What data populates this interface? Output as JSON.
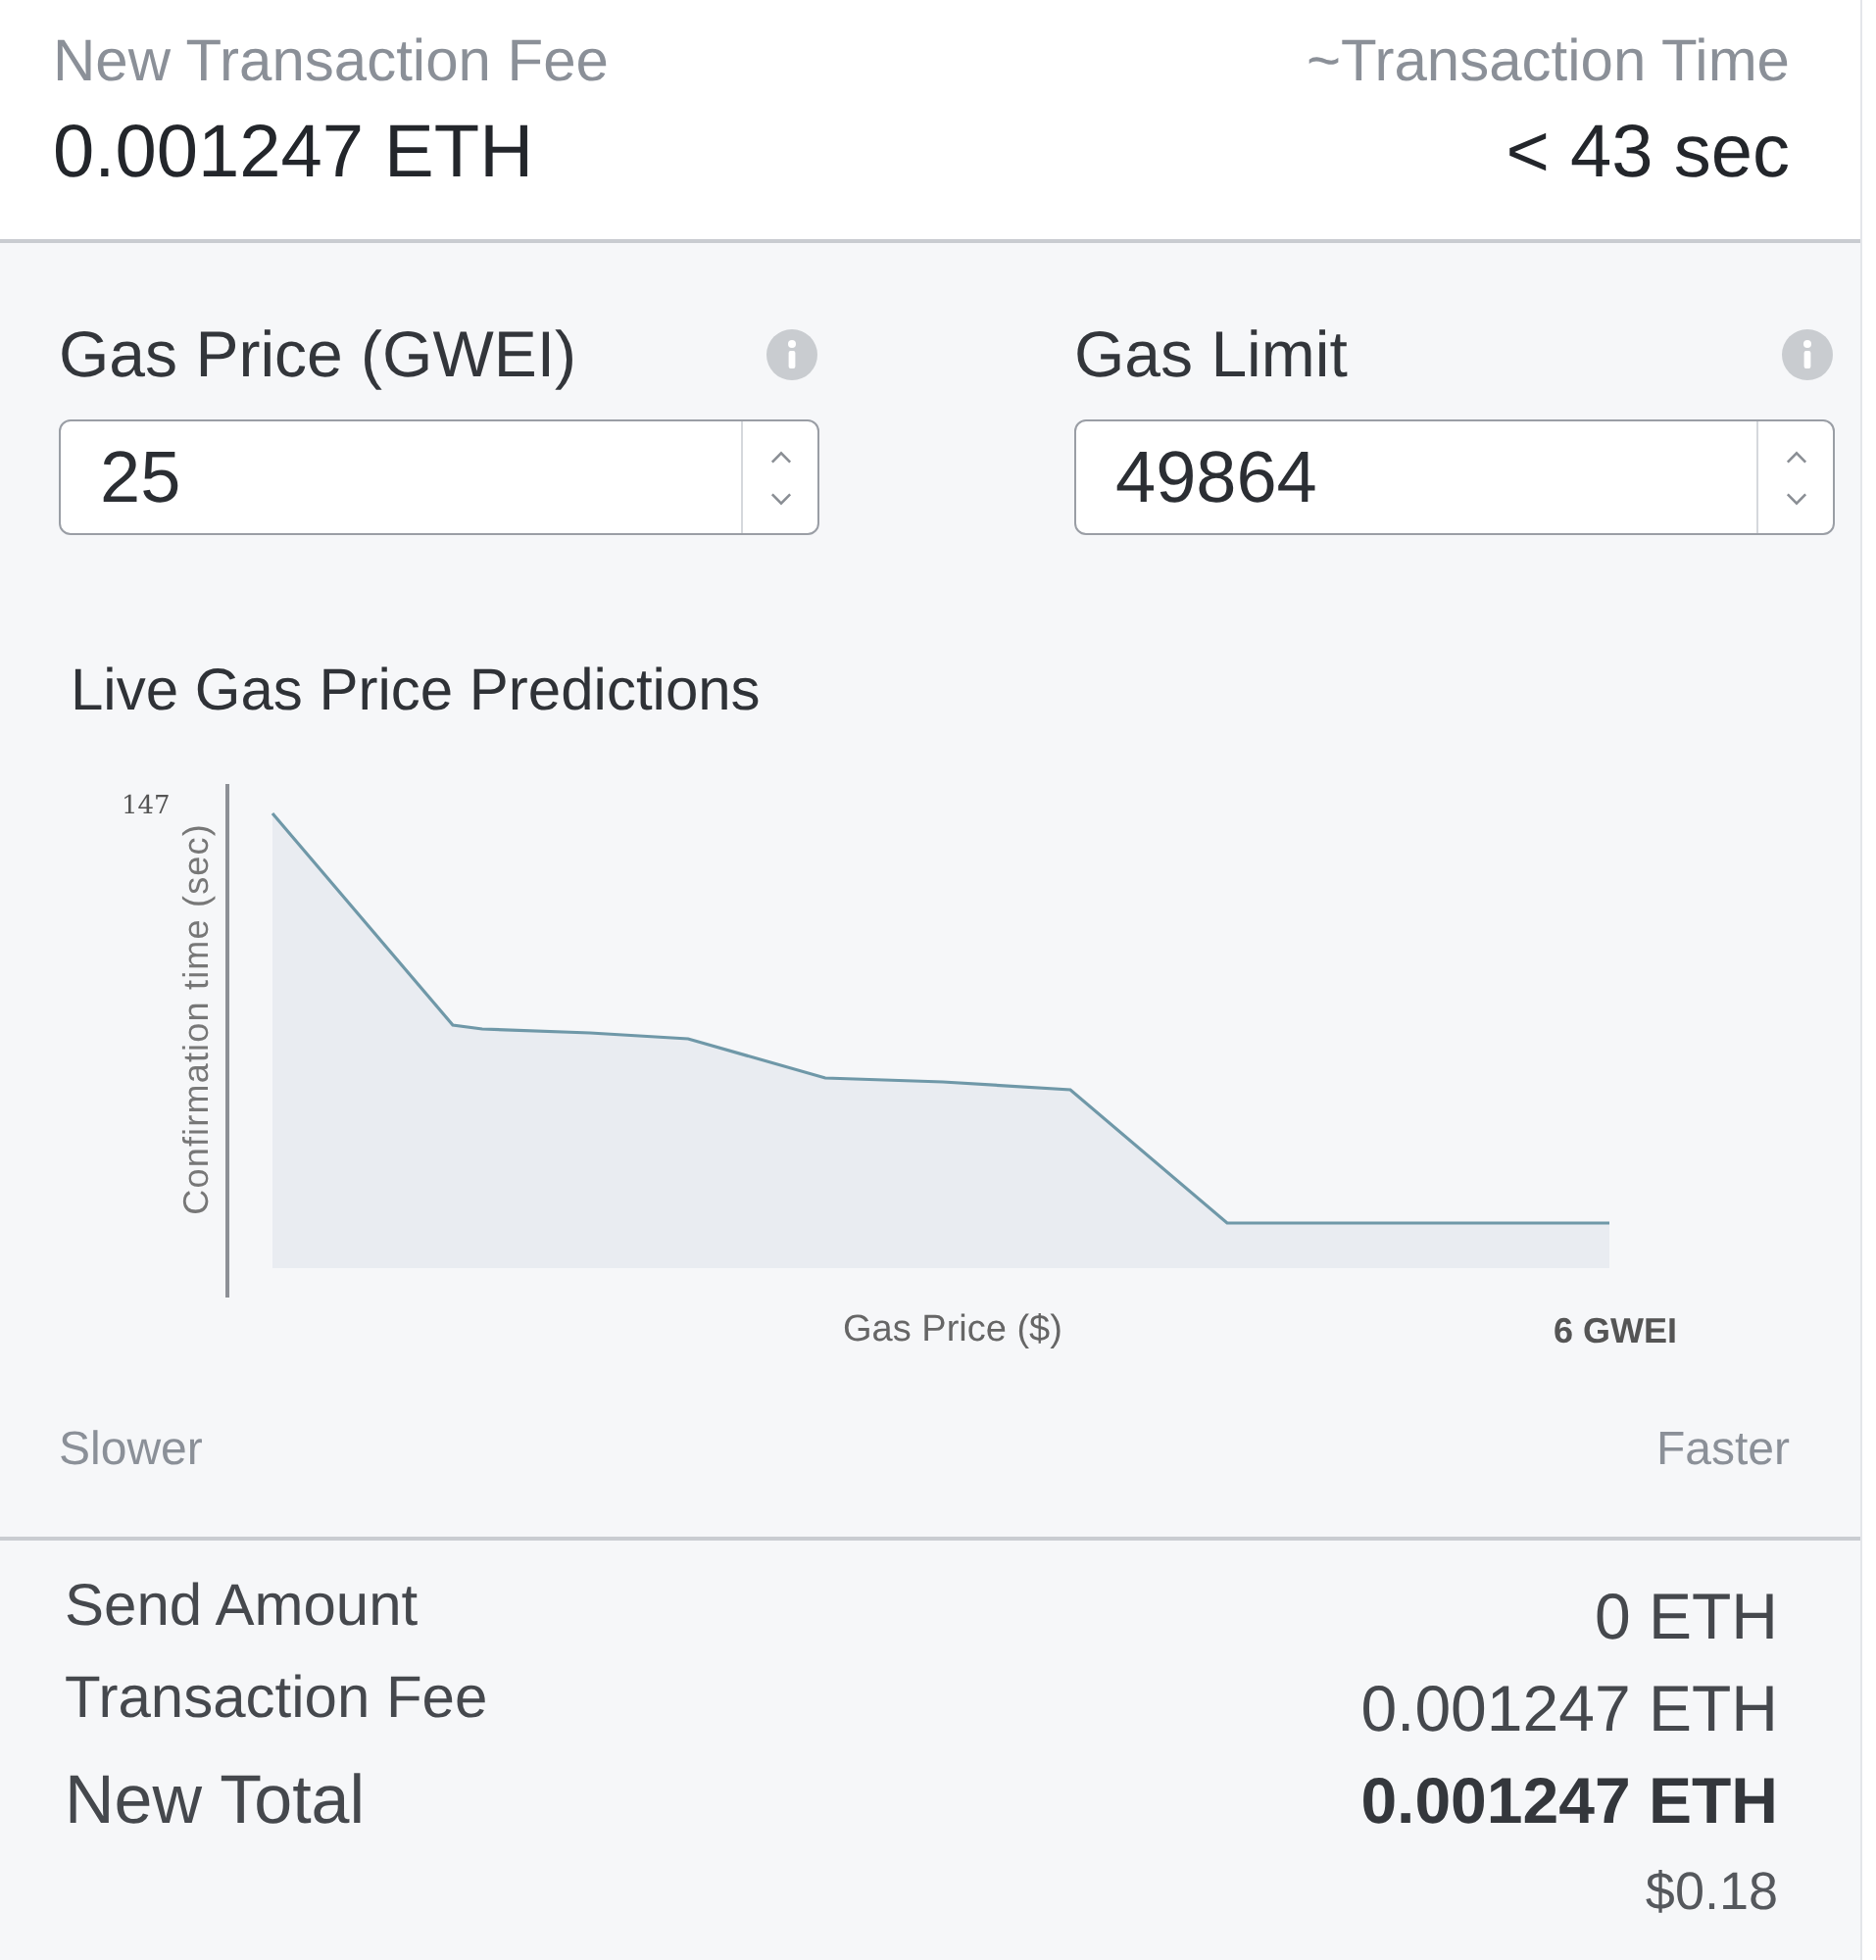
{
  "header": {
    "fee": {
      "label": "New Transaction Fee",
      "value": "0.001247 ETH"
    },
    "time": {
      "label": "~Transaction Time",
      "value": "< 43 sec"
    }
  },
  "fields": [
    {
      "label": "Gas Price (GWEI)",
      "value": "25"
    },
    {
      "label": "Gas Limit",
      "value": "49864"
    }
  ],
  "predictions": {
    "title": "Live Gas Price Predictions",
    "chart": {
      "y_tick": "147",
      "y_label": "Confirmation time (sec)",
      "x_label": "Gas Price ($)",
      "x_end": "6 GWEI"
    },
    "slower": "Slower",
    "faster": "Faster"
  },
  "summary": [
    {
      "kind": "line",
      "label": "Send Amount",
      "value": "0 ETH"
    },
    {
      "kind": "line",
      "label": "Transaction Fee",
      "value": "0.001247 ETH"
    },
    {
      "kind": "total",
      "label": "New Total",
      "value": "0.001247 ETH",
      "sub": "$0.18"
    }
  ]
}
